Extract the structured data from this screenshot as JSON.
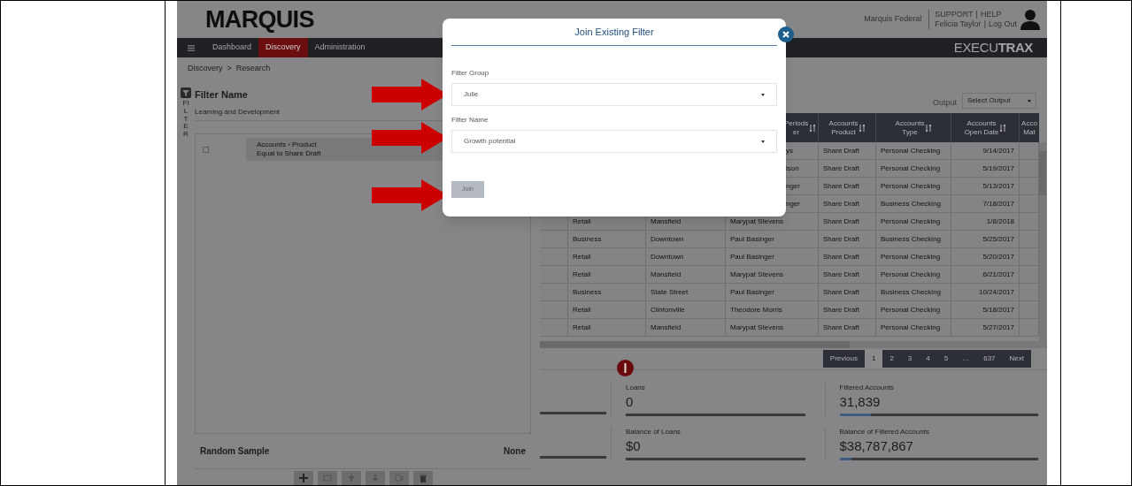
{
  "header": {
    "logo": "MARQUIS",
    "org": "Marquis Federal",
    "user_links": [
      [
        "SUPPORT",
        "HELP"
      ],
      [
        "Felicia Taylor",
        "Log Out"
      ]
    ],
    "separator": "|"
  },
  "nav": {
    "items": [
      {
        "label": "Dashboard",
        "selected": false
      },
      {
        "label": "Discovery",
        "selected": true
      },
      {
        "label": "Administration",
        "selected": false
      }
    ],
    "brand": "EXECU**TRAX**"
  },
  "breadcrumb": {
    "items": [
      "Discovery",
      "Research"
    ],
    "separator": ">"
  },
  "filter_panel": {
    "title": "Filter Name",
    "side_label": "FILTER",
    "filter_name": "Learning and Development",
    "filters": [
      {
        "checked": false,
        "line1": "Accounts › Product",
        "line2": "Equal to Share Draft"
      }
    ],
    "random_sample": {
      "label": "Random Sample",
      "value": "None"
    }
  },
  "output": {
    "label": "Output",
    "placeholder": "Select Output"
  },
  "table": {
    "columns": [
      {
        "lines": [
          "Periods",
          "er"
        ]
      },
      {
        "lines": [
          "Accounts",
          "Product"
        ]
      },
      {
        "lines": [
          "Accounts",
          "Type"
        ]
      },
      {
        "lines": [
          "Accounts",
          "Open Date"
        ]
      },
      {
        "lines": [
          "Acco",
          "Mat"
        ]
      }
    ],
    "rows": [
      {
        "covered": true,
        "cells": [
          "ys",
          "Share Draft",
          "Personal Checking",
          "9/14/2017"
        ]
      },
      {
        "covered": true,
        "cells": [
          "lson",
          "Share Draft",
          "Personal Checking",
          "5/19/2017"
        ]
      },
      {
        "covered": true,
        "cells": [
          "nger",
          "Share Draft",
          "Personal Checking",
          "5/13/2017"
        ]
      },
      {
        "covered": true,
        "cells": [
          "nger",
          "Share Draft",
          "Business Checking",
          "7/18/2017"
        ]
      },
      {
        "covered": false,
        "cells": [
          "Retail",
          "Mansfield",
          "Marypat Stevens",
          "Share Draft",
          "Personal Checking",
          "1/8/2018"
        ]
      },
      {
        "covered": false,
        "cells": [
          "Business",
          "Downtown",
          "Paul Basinger",
          "Share Draft",
          "Business Checking",
          "5/25/2017"
        ]
      },
      {
        "covered": false,
        "cells": [
          "Retail",
          "Downtown",
          "Paul Basinger",
          "Share Draft",
          "Personal Checking",
          "5/20/2017"
        ]
      },
      {
        "covered": false,
        "cells": [
          "Retail",
          "Mansfield",
          "Marypat Stevens",
          "Share Draft",
          "Personal Checking",
          "6/21/2017"
        ]
      },
      {
        "covered": false,
        "cells": [
          "Business",
          "State Street",
          "Paul Basinger",
          "Share Draft",
          "Business Checking",
          "10/24/2017"
        ]
      },
      {
        "covered": false,
        "cells": [
          "Retail",
          "Clintonville",
          "Theodore Morris",
          "Share Draft",
          "Personal Checking",
          "5/18/2017"
        ]
      },
      {
        "covered": false,
        "cells": [
          "Retail",
          "Mansfield",
          "Marypat Stevens",
          "Share Draft",
          "Personal Checking",
          "5/27/2017"
        ]
      }
    ]
  },
  "pagination": [
    {
      "label": "Previous",
      "selected": false
    },
    {
      "label": "1",
      "selected": true
    },
    {
      "label": "2",
      "selected": false
    },
    {
      "label": "3",
      "selected": false
    },
    {
      "label": "4",
      "selected": false
    },
    {
      "label": "5",
      "selected": false
    },
    {
      "label": "…",
      "selected": false
    },
    {
      "label": "637",
      "selected": false
    },
    {
      "label": "Next",
      "selected": false
    }
  ],
  "stats": [
    {
      "label": "Loans",
      "value": "0",
      "level": 0
    },
    {
      "label": "Filtered Accounts",
      "value": "31,839",
      "level": 0.16
    },
    {
      "label": "Balance of Loans",
      "value": "$0",
      "level": 0
    },
    {
      "label": "Balance of Filtered Accounts",
      "value": "$38,787,867",
      "level": 0.06
    }
  ],
  "modal": {
    "title": "Join Existing Filter",
    "fields": [
      {
        "label": "Filter Group",
        "value": "Julie"
      },
      {
        "label": "Filter Name",
        "value": "Growth potential"
      }
    ],
    "button": "Join"
  }
}
